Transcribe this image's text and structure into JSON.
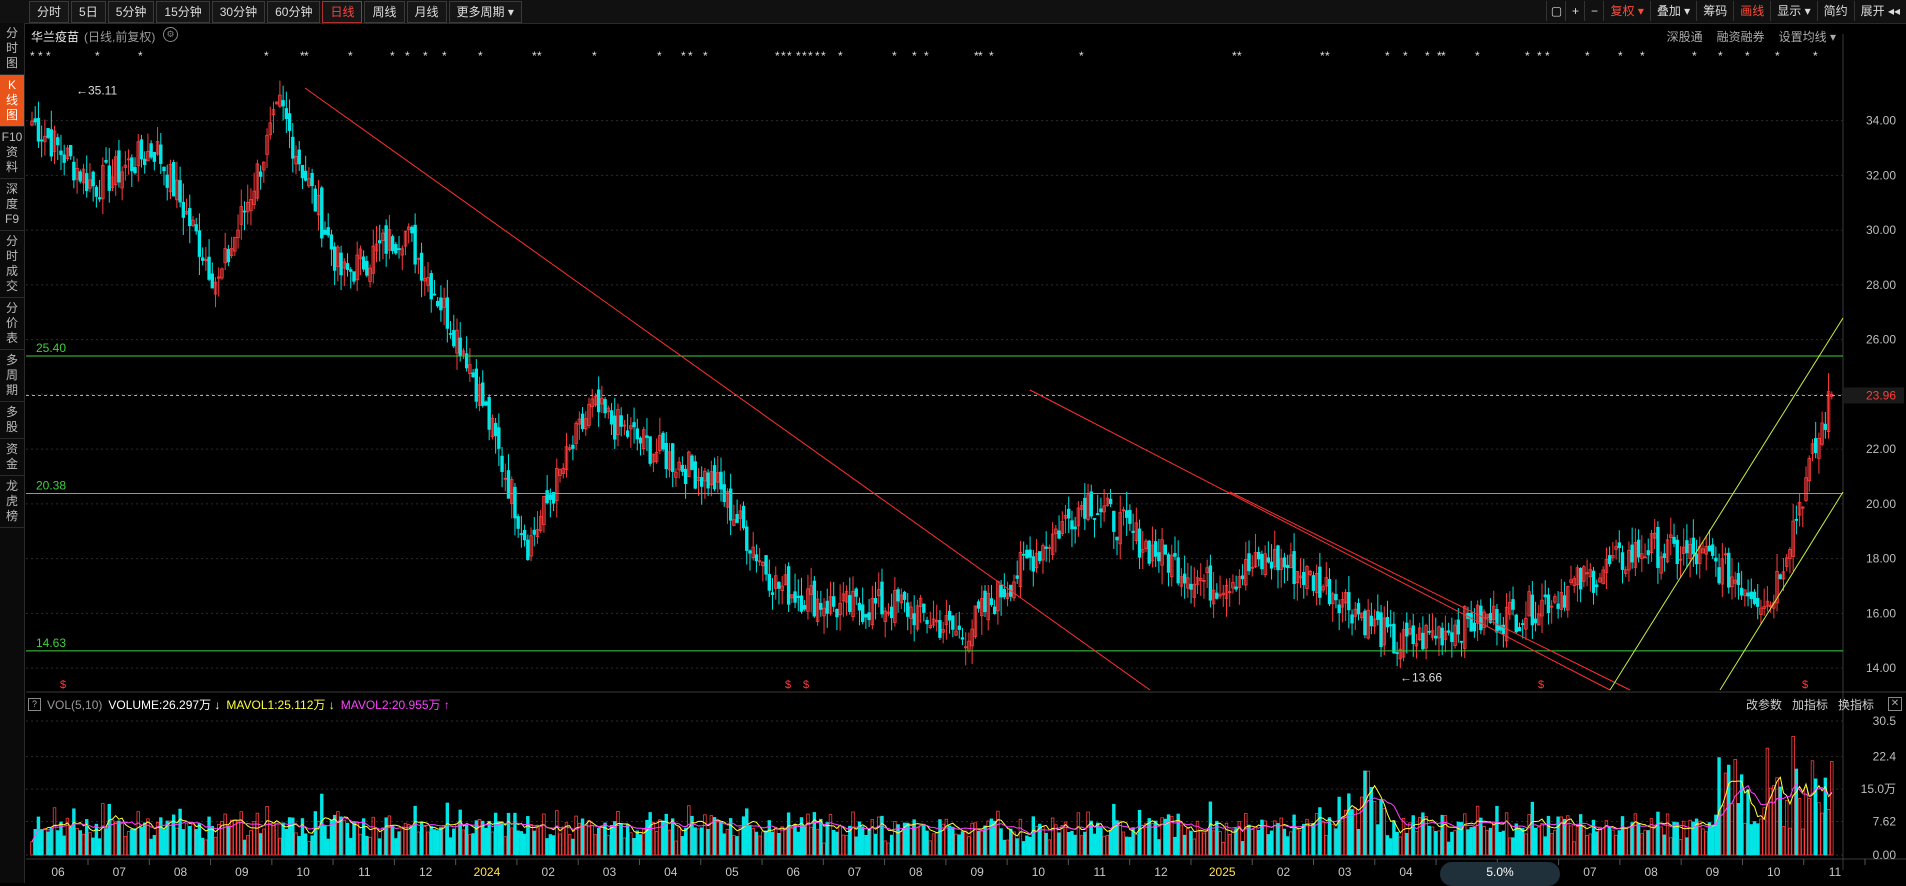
{
  "toolbar": {
    "period_tabs": [
      "分时",
      "5日",
      "5分钟",
      "15分钟",
      "30分钟",
      "60分钟",
      "日线",
      "周线",
      "月线",
      "更多周期 ▾"
    ],
    "active_period": "日线",
    "right_buttons": [
      "复权 ▾",
      "叠加 ▾",
      "筹码",
      "画线",
      "显示 ▾",
      "简约",
      "展开 ◂◂"
    ]
  },
  "sidebar": [
    "分\n时\n图",
    "K\n线\n图",
    "F10\n资\n料",
    "深\n度\nF9",
    "分\n时\n成\n交",
    "分\n价\n表",
    "多\n周\n期",
    "多\n股",
    "资\n金",
    "龙\n虎\n榜"
  ],
  "sidebar_active": 1,
  "stock": {
    "name": "华兰疫苗",
    "mode": "(日线,前复权)"
  },
  "top_links": [
    "深股通",
    "融资融券",
    "设置均线 ▾"
  ],
  "price_chart": {
    "ylim": [
      13.2,
      36.8
    ],
    "y_ticks": [
      14,
      16,
      18,
      20,
      22,
      24,
      26,
      28,
      30,
      32,
      34
    ],
    "high_label": "35.11",
    "low_label": "13.66",
    "current_price_label": "23.96",
    "h_levels": [
      {
        "value": 25.4,
        "label": "25.40"
      },
      {
        "value": 20.38,
        "label": "20.38"
      },
      {
        "value": 14.63,
        "label": "14.63"
      }
    ]
  },
  "volume_panel": {
    "indicator": "VOL(5,10)",
    "volume": "VOLUME:26.297万 ↓",
    "mavol1": "MAVOL1:25.112万 ↓",
    "mavol2": "MAVOL2:20.955万 ↑",
    "right_buttons": [
      "改参数",
      "加指标",
      "换指标"
    ],
    "y_ticks": [
      "30.5",
      "22.4",
      "15.0万",
      "7.62",
      "0.00"
    ],
    "ylim": [
      0,
      33
    ]
  },
  "x_axis_labels": [
    "06",
    "07",
    "08",
    "09",
    "10",
    "11",
    "12",
    "2024",
    "02",
    "03",
    "04",
    "05",
    "06",
    "07",
    "08",
    "09",
    "10",
    "11",
    "12",
    "2025",
    "02",
    "03",
    "04",
    "05",
    "06",
    "07",
    "08",
    "09",
    "10",
    "11"
  ],
  "bottom_badge": "5.0%",
  "colors": {
    "up": "#ff3c3c",
    "down": "#00e5e5",
    "support": "#3ed13e",
    "trend_red": "#ff3030",
    "channel": "#c8f040",
    "mavol1": "#ffff3c",
    "mavol2": "#ff40ff"
  },
  "chart_data": {
    "type": "candlestick",
    "title": "华兰疫苗",
    "series_name": "日线,前复权",
    "x": [
      "06",
      "07",
      "08",
      "09",
      "10",
      "11",
      "12",
      "2024",
      "02",
      "03",
      "04",
      "05",
      "06",
      "07",
      "08",
      "09",
      "10",
      "11",
      "12",
      "2025",
      "02",
      "03",
      "04",
      "05",
      "06",
      "07",
      "08",
      "09",
      "10",
      "11"
    ],
    "close_trend": [
      {
        "x": "06",
        "price": 34.0
      },
      {
        "x": "07",
        "price": 31.6
      },
      {
        "x": "08",
        "price": 33.0
      },
      {
        "x": "09",
        "price": 28.0
      },
      {
        "x": "10",
        "price": 34.5
      },
      {
        "x": "11",
        "price": 28.3
      },
      {
        "x": "12",
        "price": 30.0
      },
      {
        "x": "2024",
        "price": 25.5
      },
      {
        "x": "02",
        "price": 18.5
      },
      {
        "x": "03",
        "price": 23.5
      },
      {
        "x": "04",
        "price": 22.0
      },
      {
        "x": "05",
        "price": 20.8
      },
      {
        "x": "06",
        "price": 17.0
      },
      {
        "x": "07",
        "price": 16.2
      },
      {
        "x": "08",
        "price": 16.3
      },
      {
        "x": "09",
        "price": 15.2
      },
      {
        "x": "10",
        "price": 17.8
      },
      {
        "x": "11",
        "price": 20.2
      },
      {
        "x": "12",
        "price": 18.4
      },
      {
        "x": "2025",
        "price": 17.0
      },
      {
        "x": "02",
        "price": 18.0
      },
      {
        "x": "03",
        "price": 16.8
      },
      {
        "x": "04",
        "price": 14.8
      },
      {
        "x": "05",
        "price": 15.6
      },
      {
        "x": "06",
        "price": 16.0
      },
      {
        "x": "07",
        "price": 17.2
      },
      {
        "x": "08",
        "price": 18.4
      },
      {
        "x": "09",
        "price": 18.0
      },
      {
        "x": "10",
        "price": 16.4
      },
      {
        "x": "11",
        "price": 23.96
      }
    ],
    "price_ylim": [
      13.2,
      36.8
    ],
    "volume_ylim": [
      0,
      33
    ]
  }
}
